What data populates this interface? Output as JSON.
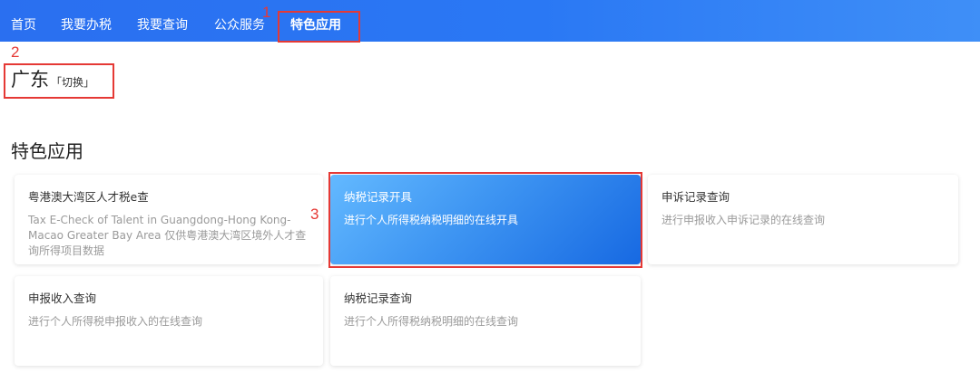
{
  "nav": {
    "items": [
      {
        "label": "首页"
      },
      {
        "label": "我要办税"
      },
      {
        "label": "我要查询"
      },
      {
        "label": "公众服务"
      },
      {
        "label": "特色应用"
      }
    ],
    "active_index": 4
  },
  "region": {
    "name": "广东",
    "switch_label": "「切换」"
  },
  "section": {
    "title": "特色应用"
  },
  "cards": [
    {
      "title": "粤港澳大湾区人才税e查",
      "desc": "Tax E-Check of Talent in Guangdong-Hong Kong-Macao Greater Bay Area 仅供粤港澳大湾区境外人才查询所得项目数据"
    },
    {
      "title": "纳税记录开具",
      "desc": "进行个人所得税纳税明细的在线开具",
      "selected": true
    },
    {
      "title": "申诉记录查询",
      "desc": "进行申报收入申诉记录的在线查询"
    },
    {
      "title": "申报收入查询",
      "desc": "进行个人所得税申报收入的在线查询"
    },
    {
      "title": "纳税记录查询",
      "desc": "进行个人所得税纳税明细的在线查询"
    }
  ],
  "annotations": {
    "nav_marker": "1",
    "region_marker": "2",
    "card_marker": "3",
    "color": "#e53935"
  },
  "colors": {
    "nav_bar": "#2a6ff0",
    "card_active_start": "#63b9ff",
    "card_active_end": "#1769e2"
  }
}
